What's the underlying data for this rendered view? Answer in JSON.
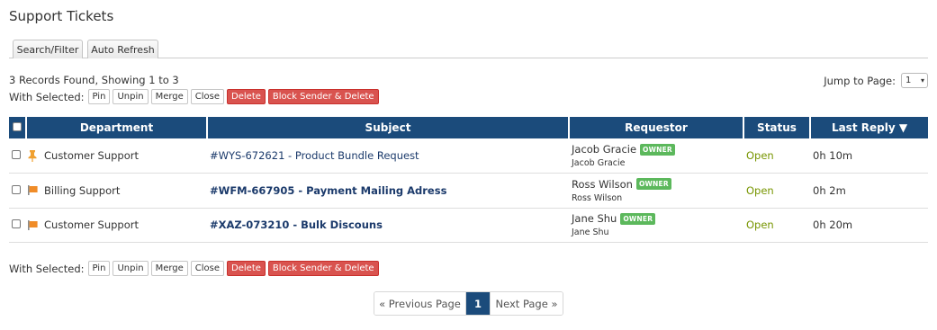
{
  "page": {
    "title": "Support Tickets"
  },
  "tabs": [
    {
      "label": "Search/Filter"
    },
    {
      "label": "Auto Refresh"
    }
  ],
  "records_info": "3 Records Found, Showing 1 to 3",
  "jump": {
    "label": "Jump to Page:",
    "value": "1",
    "arrow": "▾"
  },
  "bulk_actions": {
    "label": "With Selected:",
    "pin": "Pin",
    "unpin": "Unpin",
    "merge": "Merge",
    "close": "Close",
    "delete": "Delete",
    "block_delete": "Block Sender & Delete"
  },
  "table": {
    "headers": {
      "department": "Department",
      "subject": "Subject",
      "requestor": "Requestor",
      "status": "Status",
      "last_reply": "Last Reply ▼"
    },
    "rows": [
      {
        "department": "Customer Support",
        "icon": "pin-icon",
        "subject": "#WYS-672621 - Product Bundle Request",
        "requestor_name": "Jacob Gracie",
        "requestor_badge": "OWNER",
        "requestor_sub": "Jacob Gracie",
        "status": "Open",
        "last_reply": "0h 10m"
      },
      {
        "department": "Billing Support",
        "icon": "flag-icon",
        "subject": "#WFM-667905 - Payment Mailing Adress",
        "requestor_name": "Ross Wilson",
        "requestor_badge": "OWNER",
        "requestor_sub": "Ross Wilson",
        "status": "Open",
        "last_reply": "0h 2m"
      },
      {
        "department": "Customer Support",
        "icon": "flag-icon",
        "subject": "#XAZ-073210 - Bulk Discouns",
        "requestor_name": "Jane Shu",
        "requestor_badge": "OWNER",
        "requestor_sub": "Jane Shu",
        "status": "Open",
        "last_reply": "0h 20m"
      }
    ]
  },
  "pagination": {
    "prev": "« Previous Page",
    "current": "1",
    "next": "Next Page »"
  },
  "colors": {
    "header_bg": "#1b4b7b",
    "danger": "#d9534f",
    "owner_badge": "#5cb85c",
    "status_open": "#779500",
    "pin": "#f0a030",
    "flag": "#f08c28"
  }
}
